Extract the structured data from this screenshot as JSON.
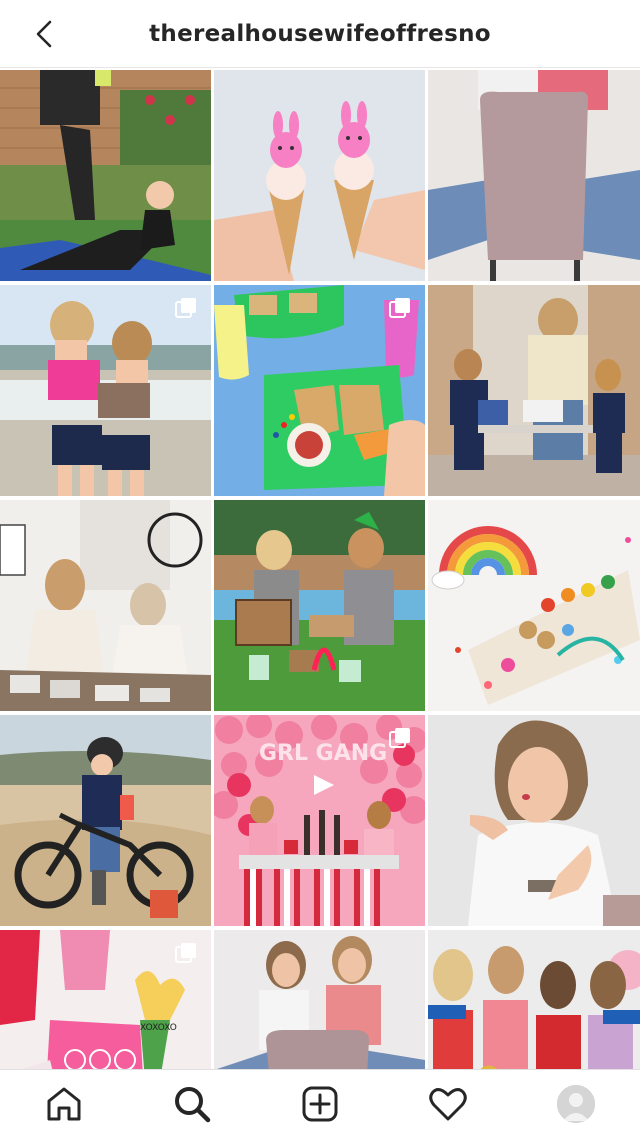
{
  "header": {
    "username": "therealhousewifeoffresno",
    "back_icon": "chevron-left-icon"
  },
  "grid": {
    "tiles": [
      {
        "subject": "Mother and daughter stretching on a yoga mat",
        "multi": false
      },
      {
        "subject": "Two hands holding ice cream cones topped with pink bunny peeps",
        "multi": false
      },
      {
        "subject": "Two women seated on a mauve velvet chair",
        "multi": false
      },
      {
        "subject": "Two girls in swimsuits on the beach",
        "multi": true
      },
      {
        "subject": "Shamrock shaped sandwiches on green plate with cups",
        "multi": true
      },
      {
        "subject": "Woman with kids at a table with snacks",
        "multi": false
      },
      {
        "subject": "Two women sorting tiles at a table",
        "multi": false
      },
      {
        "subject": "Two girls with St. Patrick's Day signs on grass",
        "multi": false
      },
      {
        "subject": "Rainbow candy charcuterie board",
        "multi": false
      },
      {
        "subject": "Toddler on a balance bike at the beach",
        "multi": false
      },
      {
        "subject": "Girls at Valentine party with pink balloon wall",
        "multi": true
      },
      {
        "subject": "Woman blowing a kiss in white lace top",
        "multi": false
      },
      {
        "subject": "Valentine's gifts with tulips and heart boxes",
        "multi": true
      },
      {
        "subject": "Two women seated on a mauve chair",
        "multi": false
      },
      {
        "subject": "Four women holding gold love balloon",
        "multi": false
      }
    ]
  },
  "bottom_nav": {
    "items": [
      {
        "name": "home-icon",
        "active": false
      },
      {
        "name": "search-icon",
        "active": true
      },
      {
        "name": "new-post-icon",
        "active": false
      },
      {
        "name": "activity-heart-icon",
        "active": false
      },
      {
        "name": "profile-avatar",
        "active": false
      }
    ]
  },
  "colors": {
    "text": "#262626",
    "divider": "#e6e6e6",
    "background": "#ffffff"
  }
}
